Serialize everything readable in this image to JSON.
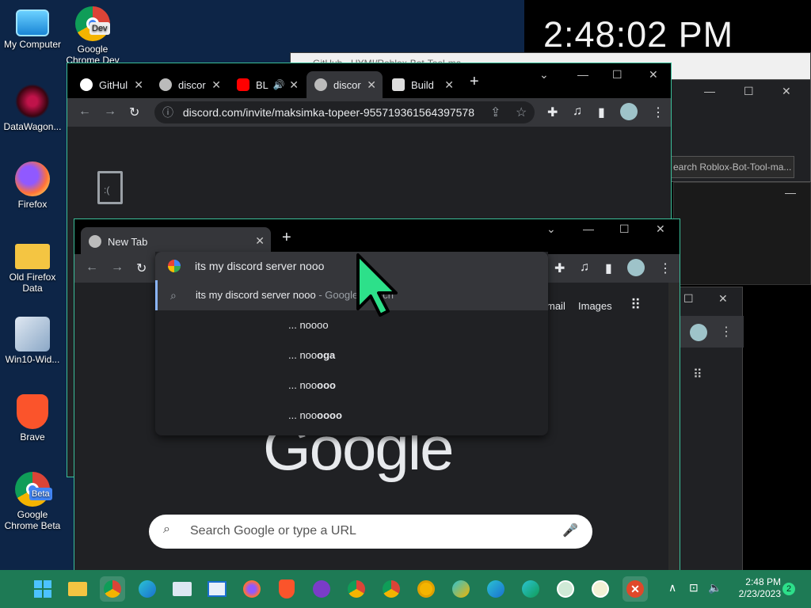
{
  "desktop": {
    "clock": "2:48:02 PM",
    "icons": [
      {
        "label": "My Computer"
      },
      {
        "label": "Google Chrome Dev",
        "badge": "Dev"
      },
      {
        "label": "DataWagon..."
      },
      {
        "label": "Firefox"
      },
      {
        "label": "Old Firefox Data"
      },
      {
        "label": "Win10-Wid..."
      },
      {
        "label": "Brave"
      },
      {
        "label": "Google Chrome Beta",
        "badge": "Beta"
      }
    ]
  },
  "bg_window": {
    "title": "GitHub - UYMI/Roblox-Bot-Tool-ma...",
    "search_text": "earch Roblox-Bot-Tool-ma..."
  },
  "browser_back": {
    "tabs": [
      {
        "label": "GitHul"
      },
      {
        "label": "discor"
      },
      {
        "label": "BL"
      },
      {
        "label": "discor"
      },
      {
        "label": "Build"
      }
    ],
    "url": "discord.com/invite/maksimka-topeer-955719361564397578"
  },
  "browser_front": {
    "tab_label": "New Tab",
    "omnibox_text": "its my discord server nooo",
    "suggestions": [
      {
        "text": "its my discord server nooo",
        "suffix": " - Google Search"
      },
      {
        "text": "... noooo",
        "bold": ""
      },
      {
        "text": "... noo",
        "bold": "oga"
      },
      {
        "text": "... noo",
        "bold": "ooo"
      },
      {
        "text": "... noo",
        "bold": "oooo"
      }
    ],
    "header_links": {
      "gmail": "mail",
      "images": "Images"
    },
    "logo": "Google",
    "search_placeholder": "Search Google or type a URL"
  },
  "taskbar": {
    "time": "2:48 PM",
    "date": "2/23/2023",
    "notification_count": "2",
    "apps": [
      {
        "name": "start"
      },
      {
        "name": "file-explorer"
      },
      {
        "name": "chrome"
      },
      {
        "name": "edge"
      },
      {
        "name": "task-manager"
      },
      {
        "name": "control-panel"
      },
      {
        "name": "firefox"
      },
      {
        "name": "brave"
      },
      {
        "name": "game-app"
      },
      {
        "name": "chrome-beta",
        "badge": "B"
      },
      {
        "name": "chrome-dev",
        "badge": "D"
      },
      {
        "name": "chrome-canary"
      },
      {
        "name": "edge-canary",
        "badge": "CAN"
      },
      {
        "name": "edge-beta",
        "badge": "BETA"
      },
      {
        "name": "edge-dev",
        "badge": "DEV"
      },
      {
        "name": "app-tool"
      },
      {
        "name": "app-tool-2"
      },
      {
        "name": "close-app"
      }
    ]
  },
  "colors": {
    "accent": "#3bbf9a",
    "taskbar": "#1e7a55",
    "cursor": "#2de08a"
  }
}
